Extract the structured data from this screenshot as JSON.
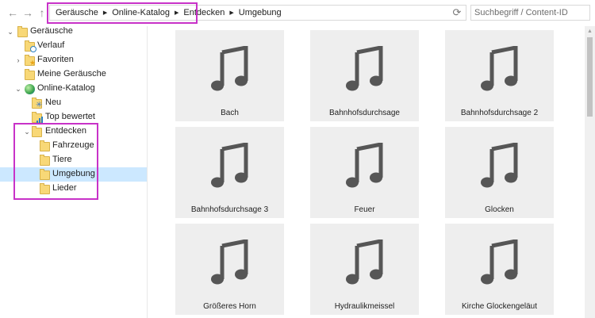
{
  "toolbar": {
    "back_icon": "arrow-left-icon",
    "forward_icon": "arrow-right-icon",
    "up_icon": "arrow-up-icon"
  },
  "breadcrumb": [
    "Geräusche",
    "Online-Katalog",
    "Entdecken",
    "Umgebung"
  ],
  "search": {
    "placeholder": "Suchbegriff / Content-ID",
    "value": ""
  },
  "highlight_color": "#c832c8",
  "sidebar": {
    "items": [
      {
        "label": "Geräusche"
      },
      {
        "label": "Verlauf"
      },
      {
        "label": "Favoriten"
      },
      {
        "label": "Meine Geräusche"
      },
      {
        "label": "Online-Katalog"
      },
      {
        "label": "Neu"
      },
      {
        "label": "Top bewertet"
      },
      {
        "label": "Entdecken"
      },
      {
        "label": "Fahrzeuge"
      },
      {
        "label": "Tiere"
      },
      {
        "label": "Umgebung"
      },
      {
        "label": "Lieder"
      }
    ]
  },
  "tiles": [
    {
      "label": "Bach"
    },
    {
      "label": "Bahnhofsdurchsage"
    },
    {
      "label": "Bahnhofsdurchsage 2"
    },
    {
      "label": "Bahnhofsdurchsage 3"
    },
    {
      "label": "Feuer"
    },
    {
      "label": "Glocken"
    },
    {
      "label": "Größeres Horn"
    },
    {
      "label": "Hydraulikmeissel"
    },
    {
      "label": "Kirche Glockengeläut"
    }
  ]
}
